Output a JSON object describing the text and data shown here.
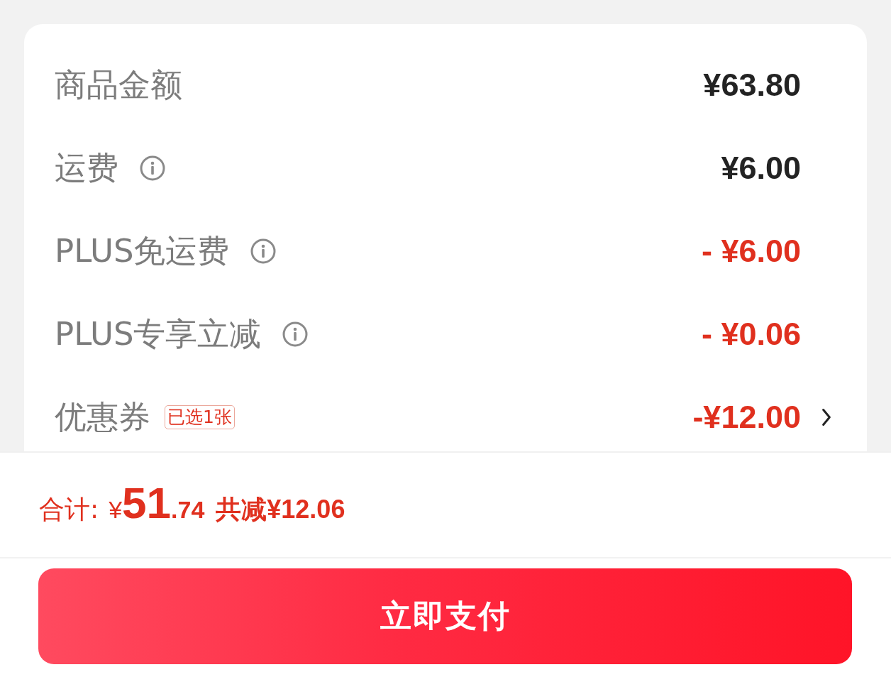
{
  "fee_rows": [
    {
      "label": "商品金额",
      "info": false,
      "value": "¥63.80",
      "discount": false,
      "chevron": false
    },
    {
      "label": "运费",
      "info": true,
      "value": "¥6.00",
      "discount": false,
      "chevron": false
    },
    {
      "label": "PLUS免运费",
      "info": true,
      "value": "- ¥6.00",
      "discount": true,
      "chevron": false
    },
    {
      "label": "PLUS专享立减",
      "info": true,
      "value": "- ¥0.06",
      "discount": true,
      "chevron": false
    },
    {
      "label": "优惠券",
      "info": false,
      "badge": "已选1张",
      "value": "-¥12.00",
      "discount": true,
      "chevron": true
    }
  ],
  "total": {
    "label": "合计:",
    "currency": "¥",
    "integer": "51",
    "decimal": ".74",
    "saving": "共减¥12.06"
  },
  "pay_button": {
    "label": "立即支付"
  }
}
